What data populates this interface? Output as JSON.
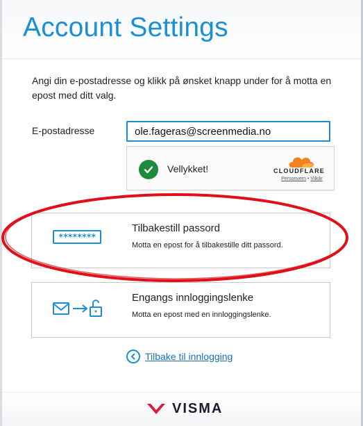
{
  "header": {
    "title": "Account Settings"
  },
  "intro": "Angi din e-postadresse og klikk på ønsket knapp under for å motta en epost med ditt valg.",
  "email": {
    "label": "E-postadresse",
    "value": "ole.fageras@screenmedia.no"
  },
  "captcha": {
    "status": "Vellykket!",
    "brand": "CLOUDFLARE",
    "privacy": "Personvern",
    "separator": "•",
    "terms": "Vilkår"
  },
  "options": {
    "reset": {
      "title": "Tilbakestill passord",
      "desc": "Motta en epost for å tilbakestille ditt passord.",
      "icon_text": "********",
      "icon": "password-field-icon"
    },
    "link": {
      "title": "Engangs innloggingslenke",
      "desc": "Motta en epost med en innloggingslenke.",
      "icon": "mail-to-unlock-icon"
    }
  },
  "back": {
    "label": "Tilbake til innlogging",
    "icon": "chevron-left-circle-icon"
  },
  "footer": {
    "brand": "VISMA"
  },
  "colors": {
    "accent": "#1b8fd6",
    "success": "#1e8a3b",
    "cloudflare_orange": "#f48120",
    "visma_red": "#d81e3a",
    "annotation_red": "#e0101a"
  }
}
